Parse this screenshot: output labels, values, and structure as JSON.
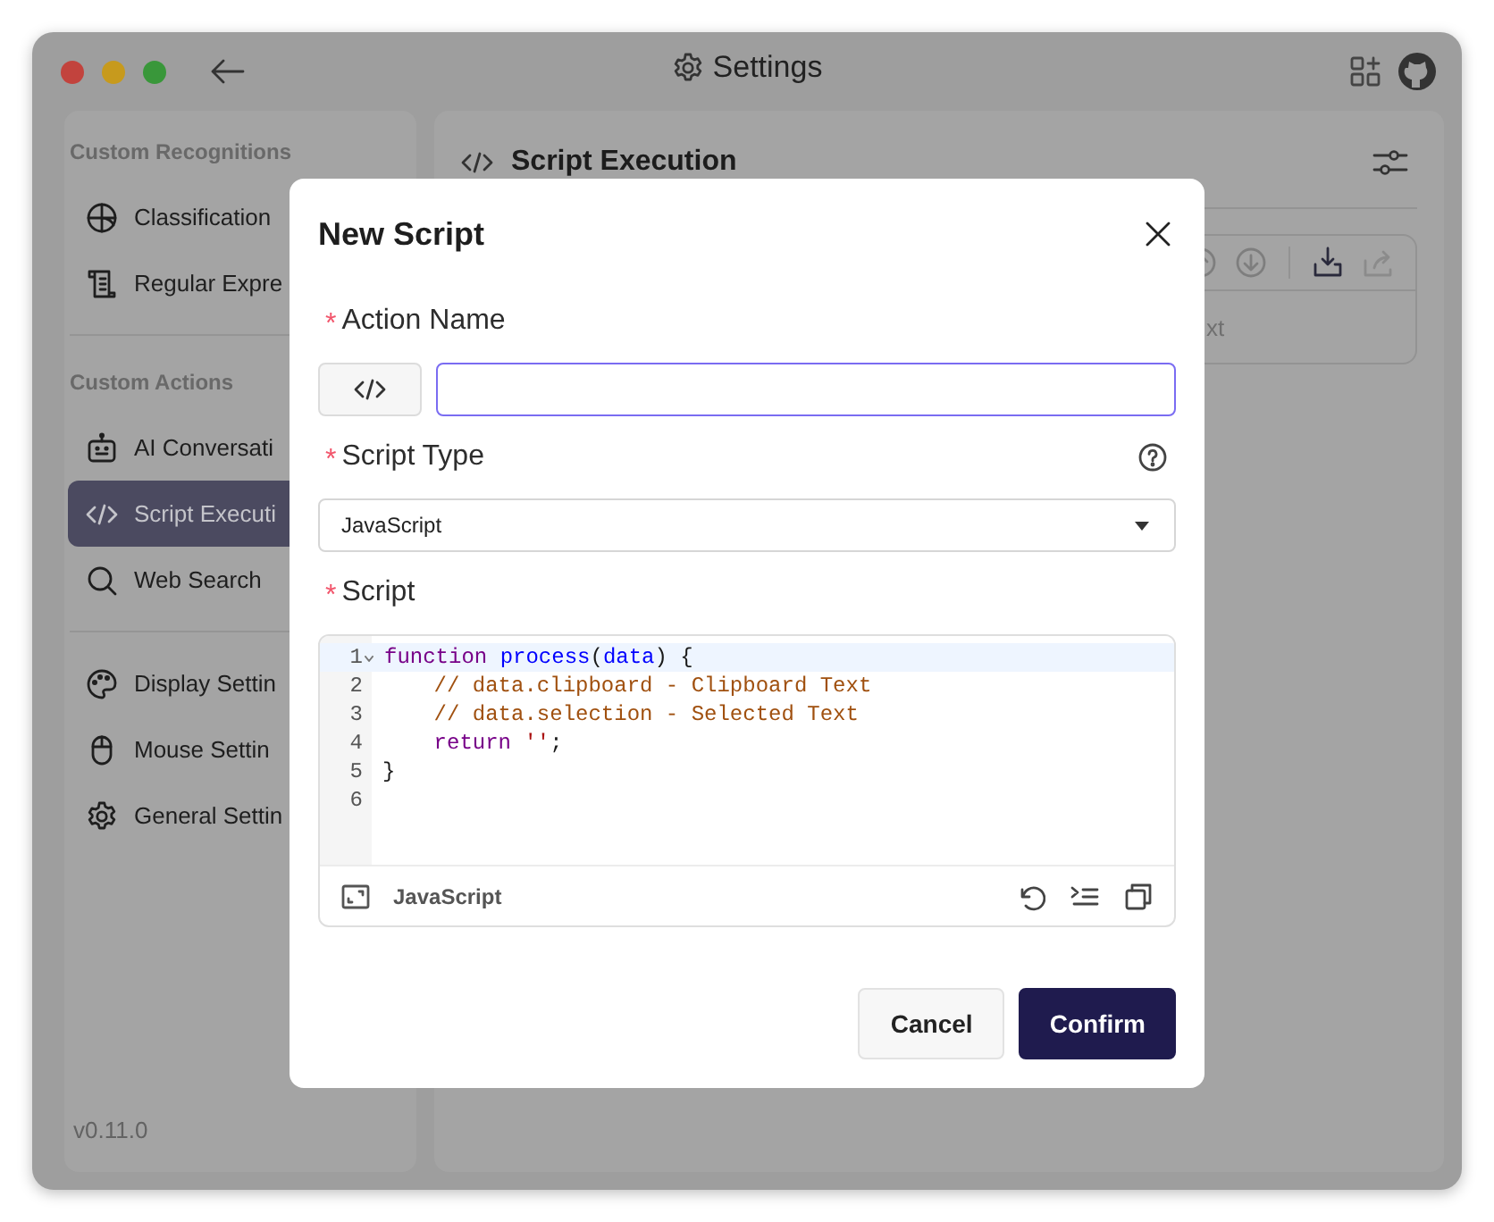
{
  "window": {
    "title": "Settings"
  },
  "sidebar": {
    "sections": [
      {
        "heading": "Custom Recognitions",
        "items": [
          {
            "label": "Classification",
            "selected": false
          },
          {
            "label": "Regular Expre",
            "selected": false
          }
        ]
      },
      {
        "heading": "Custom Actions",
        "items": [
          {
            "label": "AI Conversati",
            "selected": false
          },
          {
            "label": "Script Executi",
            "selected": true
          },
          {
            "label": "Web Search",
            "selected": false
          }
        ]
      },
      {
        "items": [
          {
            "label": "Display Settin",
            "selected": false
          },
          {
            "label": "Mouse Settin",
            "selected": false
          },
          {
            "label": "General Settin",
            "selected": false
          }
        ]
      }
    ],
    "version": "v0.11.0"
  },
  "panel": {
    "title": "Script Execution",
    "card_text": "xt"
  },
  "dialog": {
    "title": "New Script",
    "fields": [
      {
        "kind": "text",
        "label": "Action Name",
        "required_mark": "*",
        "focused": true
      },
      {
        "kind": "select",
        "label": "Script Type",
        "required_mark": "*",
        "value": "JavaScript",
        "help": true
      },
      {
        "kind": "code",
        "label": "Script",
        "required_mark": "*",
        "language": "JavaScript",
        "lines": [
          {
            "number": "1",
            "active": true,
            "tokens": [
              {
                "color": "#770088",
                "text": "function "
              },
              {
                "color": "#0000ff",
                "text": "process"
              },
              {
                "color": "#1a1a1a",
                "text": "("
              },
              {
                "color": "#0000ff",
                "text": "data"
              },
              {
                "color": "#1a1a1a",
                "text": ") {"
              }
            ]
          },
          {
            "number": "2",
            "active": false,
            "tokens": [
              {
                "color": "#a0500f",
                "text": "    // data.clipboard - Clipboard Text"
              }
            ]
          },
          {
            "number": "3",
            "active": false,
            "tokens": [
              {
                "color": "#a0500f",
                "text": "    // data.selection - Selected Text"
              }
            ]
          },
          {
            "number": "4",
            "active": false,
            "tokens": [
              {
                "color": "#770088",
                "text": "    return "
              },
              {
                "color": "#aa1111",
                "text": "''"
              },
              {
                "color": "#1a1a1a",
                "text": ";"
              }
            ]
          },
          {
            "number": "5",
            "active": false,
            "tokens": [
              {
                "color": "#1a1a1a",
                "text": "}"
              }
            ]
          },
          {
            "number": "6",
            "active": false
          }
        ]
      }
    ],
    "buttons": [
      {
        "label": "Cancel",
        "primary": false
      },
      {
        "label": "Confirm",
        "primary": true
      }
    ]
  }
}
